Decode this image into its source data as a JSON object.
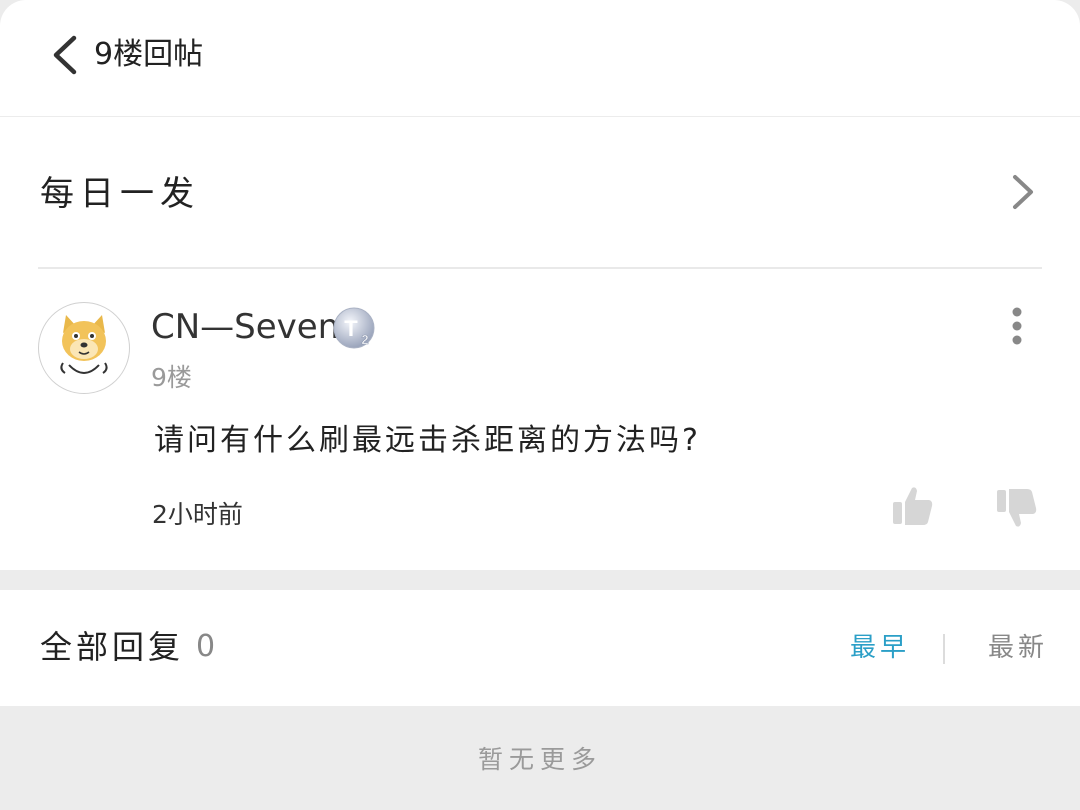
{
  "header": {
    "title": "9楼回帖",
    "back_icon": "chevron-left-icon"
  },
  "section": {
    "name": "每日一发",
    "chevron_icon": "chevron-right-icon"
  },
  "post": {
    "username": "CN—Seven",
    "level_badge": "T2",
    "floor": "9楼",
    "content": "请问有什么刷最远击杀距离的方法吗?",
    "time": "2小时前",
    "avatar_icon": "doge-avatar",
    "more_icon": "more-vertical-icon",
    "like_icon": "thumbs-up-icon",
    "dislike_icon": "thumbs-down-icon"
  },
  "replies": {
    "title": "全部回复",
    "count": "0",
    "sort_earliest": "最早",
    "sort_newest": "最新"
  },
  "footer": {
    "no_more": "暂无更多"
  },
  "colors": {
    "accent": "#2b9fc7",
    "muted": "#9a9a9a",
    "background": "#ececec"
  }
}
